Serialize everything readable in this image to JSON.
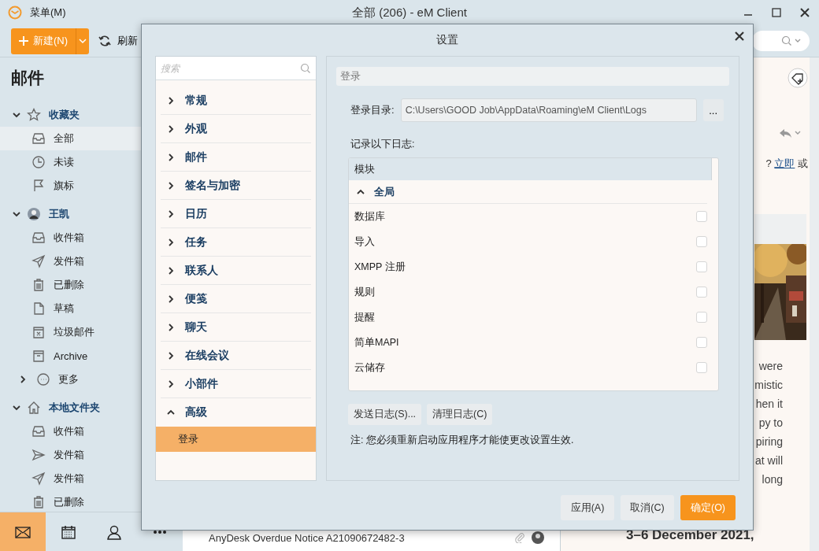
{
  "window": {
    "menu": "菜单(M)",
    "title": "全部 (206) - eM Client"
  },
  "toolbar": {
    "new_button": "新建(N)",
    "refresh_button": "刷新"
  },
  "sidebar": {
    "heading": "邮件",
    "groups": [
      {
        "label": "收藏夹",
        "kind": "favorites",
        "expanded": true,
        "items": [
          {
            "label": "全部",
            "kind": "inbox",
            "selected": true
          },
          {
            "label": "未读",
            "kind": "clock",
            "selected": false
          },
          {
            "label": "旗标",
            "kind": "flag",
            "selected": false
          }
        ]
      },
      {
        "label": "王凯",
        "kind": "account",
        "expanded": true,
        "items": [
          {
            "label": "收件箱",
            "kind": "inbox",
            "selected": false
          },
          {
            "label": "发件箱",
            "kind": "send",
            "selected": false
          },
          {
            "label": "已删除",
            "kind": "trash",
            "selected": false
          },
          {
            "label": "草稿",
            "kind": "draft",
            "selected": false
          },
          {
            "label": "垃圾邮件",
            "kind": "junk",
            "selected": false
          },
          {
            "label": "Archive",
            "kind": "archive",
            "selected": false
          },
          {
            "label": "更多",
            "kind": "more",
            "selected": false
          }
        ]
      },
      {
        "label": "本地文件夹",
        "kind": "local",
        "expanded": true,
        "items": [
          {
            "label": "收件箱",
            "kind": "inbox",
            "selected": false
          },
          {
            "label": "发件箱",
            "kind": "outbox",
            "selected": false
          },
          {
            "label": "发件箱",
            "kind": "send",
            "selected": false
          },
          {
            "label": "已删除",
            "kind": "trash",
            "selected": false
          }
        ]
      }
    ]
  },
  "nav": [
    {
      "kind": "mail",
      "selected": true
    },
    {
      "kind": "calendar",
      "selected": false
    },
    {
      "kind": "contacts",
      "selected": false
    },
    {
      "kind": "more",
      "selected": false
    }
  ],
  "message_list": {
    "rows": [
      {
        "subject": "AnyDesk Overdue Notice A21090672482-3"
      }
    ]
  },
  "reader": {
    "prompt": "? ",
    "prompt_link": "立即",
    "prompt_end": " 或",
    "body_lines": [
      "were",
      "mistic",
      "hen it",
      "py to",
      "piring",
      "at will",
      "long"
    ],
    "heading": "3–6 December 2021,"
  },
  "dialog": {
    "title": "设置",
    "search": {
      "placeholder": "搜索"
    },
    "categories": [
      {
        "label": "常规",
        "expanded": false,
        "selected": false
      },
      {
        "label": "外观",
        "expanded": false,
        "selected": false
      },
      {
        "label": "邮件",
        "expanded": false,
        "selected": false
      },
      {
        "label": "签名与加密",
        "expanded": false,
        "selected": false
      },
      {
        "label": "日历",
        "expanded": false,
        "selected": false
      },
      {
        "label": "任务",
        "expanded": false,
        "selected": false
      },
      {
        "label": "联系人",
        "expanded": false,
        "selected": false
      },
      {
        "label": "便笺",
        "expanded": false,
        "selected": false
      },
      {
        "label": "聊天",
        "expanded": false,
        "selected": false
      },
      {
        "label": "在线会议",
        "expanded": false,
        "selected": false
      },
      {
        "label": "小部件",
        "expanded": false,
        "selected": false
      },
      {
        "label": "高级",
        "expanded": true,
        "selected": false,
        "children": [
          {
            "label": "登录",
            "selected": true
          }
        ]
      }
    ],
    "section_title": "登录",
    "directory_label": "登录目录:",
    "directory_value": "C:\\Users\\GOOD Job\\AppData\\Roaming\\eM Client\\Logs",
    "browse_button": "...",
    "log_label": "记录以下日志:",
    "log_table": {
      "column": "模块",
      "groups": [
        {
          "label": "全局",
          "expanded": true,
          "rows": [
            {
              "label": "数据库",
              "checked": false
            },
            {
              "label": "导入",
              "checked": false
            },
            {
              "label": "XMPP 注册",
              "checked": false
            },
            {
              "label": "规则",
              "checked": false
            },
            {
              "label": "提醒",
              "checked": false
            },
            {
              "label": "简单MAPI",
              "checked": false
            },
            {
              "label": "云储存",
              "checked": false
            }
          ]
        }
      ]
    },
    "log_buttons": [
      "发送日志(S)...",
      "清理日志(C)"
    ],
    "note": "注: 您必须重新启动应用程序才能使更改设置生效.",
    "buttons": [
      {
        "label": "应用(A)",
        "primary": false
      },
      {
        "label": "取消(C)",
        "primary": false
      },
      {
        "label": "确定(O)",
        "primary": true
      }
    ]
  }
}
